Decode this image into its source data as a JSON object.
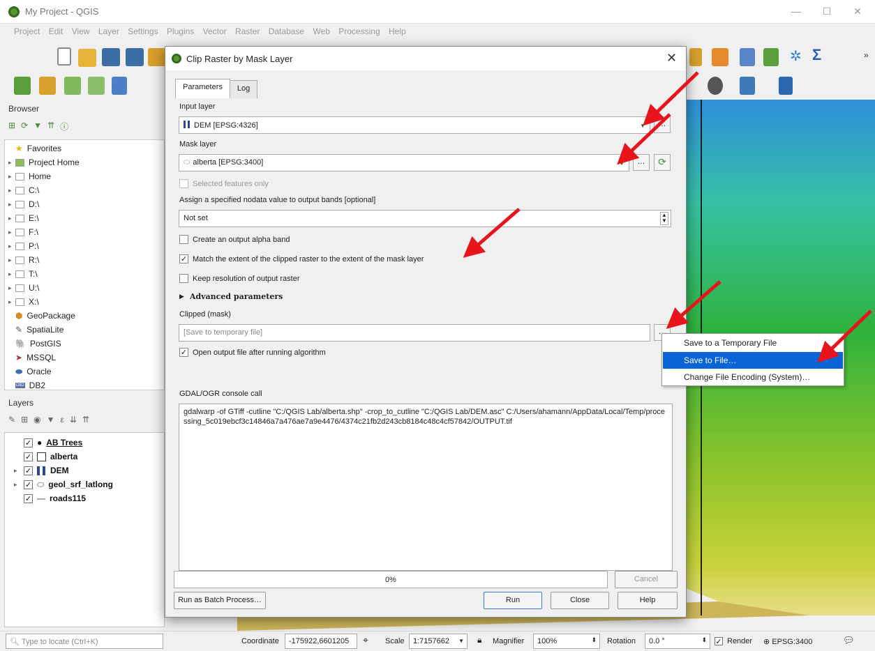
{
  "window": {
    "title": "My Project - QGIS"
  },
  "menu": [
    "Project",
    "Edit",
    "View",
    "Layer",
    "Settings",
    "Plugins",
    "Vector",
    "Raster",
    "Database",
    "Web",
    "Processing",
    "Help"
  ],
  "browser": {
    "title": "Browser",
    "items": [
      {
        "label": "Favorites",
        "icon": "star-icon"
      },
      {
        "label": "Project Home",
        "icon": "project-home-icon"
      },
      {
        "label": "Home",
        "icon": "home-icon"
      },
      {
        "label": "C:\\",
        "icon": "folder-icon"
      },
      {
        "label": "D:\\",
        "icon": "folder-icon"
      },
      {
        "label": "E:\\",
        "icon": "folder-icon"
      },
      {
        "label": "F:\\",
        "icon": "folder-icon"
      },
      {
        "label": "P:\\",
        "icon": "folder-icon"
      },
      {
        "label": "R:\\",
        "icon": "folder-icon"
      },
      {
        "label": "T:\\",
        "icon": "folder-icon"
      },
      {
        "label": "U:\\",
        "icon": "folder-icon"
      },
      {
        "label": "X:\\",
        "icon": "folder-icon"
      },
      {
        "label": "GeoPackage",
        "icon": "geopackage-icon"
      },
      {
        "label": "SpatiaLite",
        "icon": "spatialite-icon"
      },
      {
        "label": "PostGIS",
        "icon": "postgis-icon"
      },
      {
        "label": "MSSQL",
        "icon": "mssql-icon"
      },
      {
        "label": "Oracle",
        "icon": "oracle-icon"
      },
      {
        "label": "DB2",
        "icon": "db2-icon"
      }
    ]
  },
  "layers": {
    "title": "Layers",
    "items": [
      {
        "label": "AB Trees"
      },
      {
        "label": "alberta"
      },
      {
        "label": "DEM"
      },
      {
        "label": "geol_srf_latlong"
      },
      {
        "label": "roads115"
      }
    ]
  },
  "dialog": {
    "title": "Clip Raster by Mask Layer",
    "tabs": [
      "Parameters",
      "Log"
    ],
    "input_layer_label": "Input layer",
    "input_layer_value": "DEM [EPSG:4326]",
    "mask_layer_label": "Mask layer",
    "mask_layer_value": "alberta [EPSG:3400]",
    "selected_features_only": "Selected features only",
    "nodata_label": "Assign a specified nodata value to output bands [optional]",
    "nodata_value": "Not set",
    "alpha_band": "Create an output alpha band",
    "match_extent": "Match the extent of the clipped raster to the extent of the mask layer",
    "keep_resolution": "Keep resolution of output raster",
    "advanced": "Advanced parameters",
    "clipped_label": "Clipped (mask)",
    "clipped_placeholder": "[Save to temporary file]",
    "open_output": "Open output file after running algorithm",
    "console_label": "GDAL/OGR console call",
    "console_text": "gdalwarp -of GTiff -cutline \"C:/QGIS Lab/alberta.shp\" -crop_to_cutline \"C:/QGIS Lab/DEM.asc\" C:/Users/ahamann/AppData/Local/Temp/processing_5c019ebcf3c14846a7a476ae7a9e4476/4374c21fb2d243cb8184c48c4cf57842/OUTPUT.tif",
    "progress": "0%",
    "cancel": "Cancel",
    "batch": "Run as Batch Process…",
    "run": "Run",
    "close": "Close",
    "help": "Help",
    "ellipsis": "…"
  },
  "context_menu": {
    "items": [
      "Save to a Temporary File",
      "Save to File…",
      "Change File Encoding (System)…"
    ],
    "selected_index": 1
  },
  "status": {
    "locate_placeholder": "Type to locate (Ctrl+K)",
    "coordinate_label": "Coordinate",
    "coordinate_value": "-175922,6601205",
    "scale_label": "Scale",
    "scale_value": "1:7157662",
    "magnifier_label": "Magnifier",
    "magnifier_value": "100%",
    "rotation_label": "Rotation",
    "rotation_value": "0.0 °",
    "render_label": "Render",
    "crs": "EPSG:3400"
  },
  "colors": {
    "accent": "#0a64d6",
    "arrow": "#e8141b",
    "qgis_green": "#589632"
  }
}
